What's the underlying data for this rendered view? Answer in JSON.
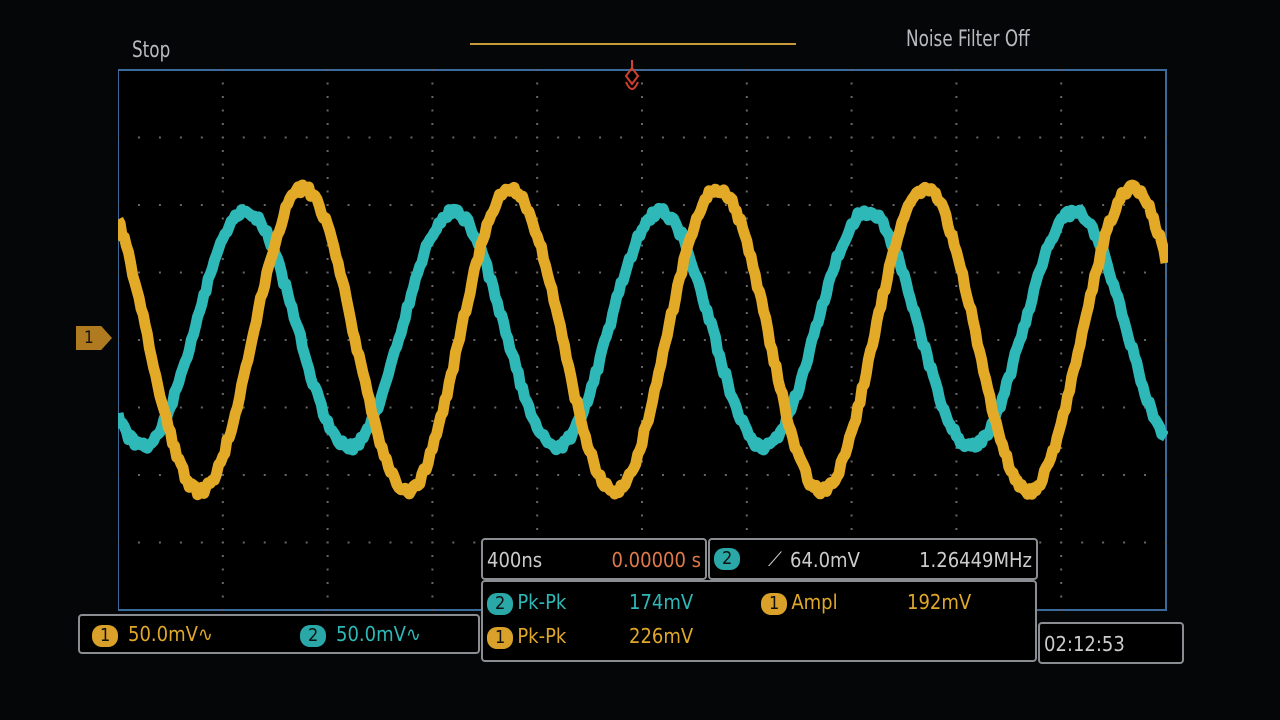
{
  "status": {
    "run_state": "Stop",
    "noise_filter": "Noise Filter Off"
  },
  "timebase": {
    "scale": "400ns",
    "delay": "0.00000 s"
  },
  "trigger": {
    "channel": "2",
    "slope_icon": "rising-edge-icon",
    "level": "64.0mV",
    "frequency": "1.26449MHz"
  },
  "channels": [
    {
      "num": "1",
      "scale": "50.0mV",
      "coupling_icon": "ac-coupling-icon",
      "color": "#e0a82a"
    },
    {
      "num": "2",
      "scale": "50.0mV",
      "coupling_icon": "ac-coupling-icon",
      "color": "#2fb8b8"
    }
  ],
  "measurements": [
    {
      "ch": "2",
      "name": "Pk-Pk",
      "value": "174mV"
    },
    {
      "ch": "1",
      "name": "Ampl",
      "value": "192mV"
    },
    {
      "ch": "1",
      "name": "Pk-Pk",
      "value": "226mV"
    }
  ],
  "ground_marker": "1",
  "clock": "02:12:53",
  "chart_data": {
    "type": "line",
    "x_unit": "ns",
    "y_unit": "mV",
    "xlim": [
      -2000,
      2000
    ],
    "ylim": [
      -200,
      200
    ],
    "x_divisions": 10,
    "y_divisions": 8,
    "grid": true,
    "series": [
      {
        "name": "Channel 1",
        "color": "#e0a82a",
        "frequency_mhz": 1.26449,
        "amplitude_mv": 112,
        "offset_mv": 0,
        "peak_time_ns": 290
      },
      {
        "name": "Channel 2",
        "color": "#2fb8b8",
        "frequency_mhz": 1.26449,
        "amplitude_mv": 87,
        "offset_mv": 8,
        "peak_time_ns": 70
      }
    ]
  }
}
